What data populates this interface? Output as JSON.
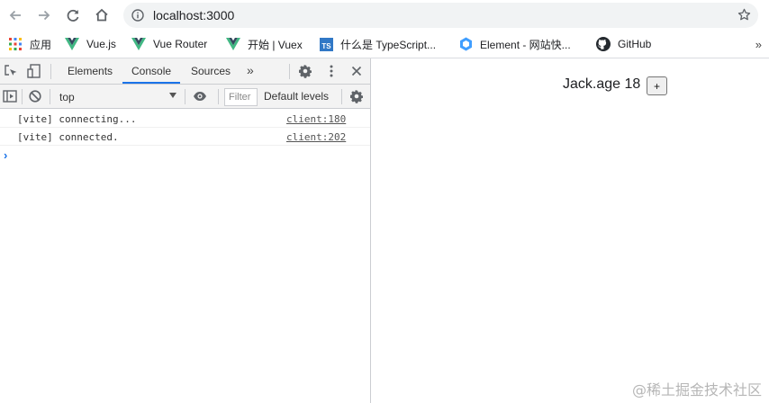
{
  "browser": {
    "url": "localhost:3000",
    "icons": {
      "back": "back-arrow-icon",
      "forward": "forward-arrow-icon",
      "reload": "reload-icon",
      "home": "home-icon",
      "info": "info-icon",
      "star": "star-icon"
    }
  },
  "bookmarks": {
    "items": [
      {
        "label": "应用",
        "icon": "apps-grid-icon"
      },
      {
        "label": "Vue.js",
        "icon": "vue-logo-icon"
      },
      {
        "label": "Vue Router",
        "icon": "vue-logo-icon"
      },
      {
        "label": "开始 | Vuex",
        "icon": "vue-logo-icon"
      },
      {
        "label": "什么是 TypeScript...",
        "icon": "typescript-logo-icon"
      },
      {
        "label": "Element - 网站快...",
        "icon": "element-logo-icon"
      },
      {
        "label": "GitHub",
        "icon": "github-logo-icon"
      }
    ],
    "overflow": "»"
  },
  "devtools": {
    "tabs": [
      "Elements",
      "Console",
      "Sources"
    ],
    "active_tab": "Console",
    "tabs_overflow": "»",
    "console_toolbar": {
      "context": "top",
      "filter_placeholder": "Filter",
      "levels": "Default levels"
    },
    "messages": [
      {
        "text": "[vite] connecting...",
        "source": "client:180"
      },
      {
        "text": "[vite] connected.",
        "source": "client:202"
      }
    ],
    "prompt": "›"
  },
  "page": {
    "age_text": "Jack.age 18",
    "button_label": "+"
  },
  "watermark": "@稀土掘金技术社区",
  "colors": {
    "accent_blue": "#1a73e8",
    "vue_green": "#41b883",
    "typescript_blue": "#3178c6"
  }
}
